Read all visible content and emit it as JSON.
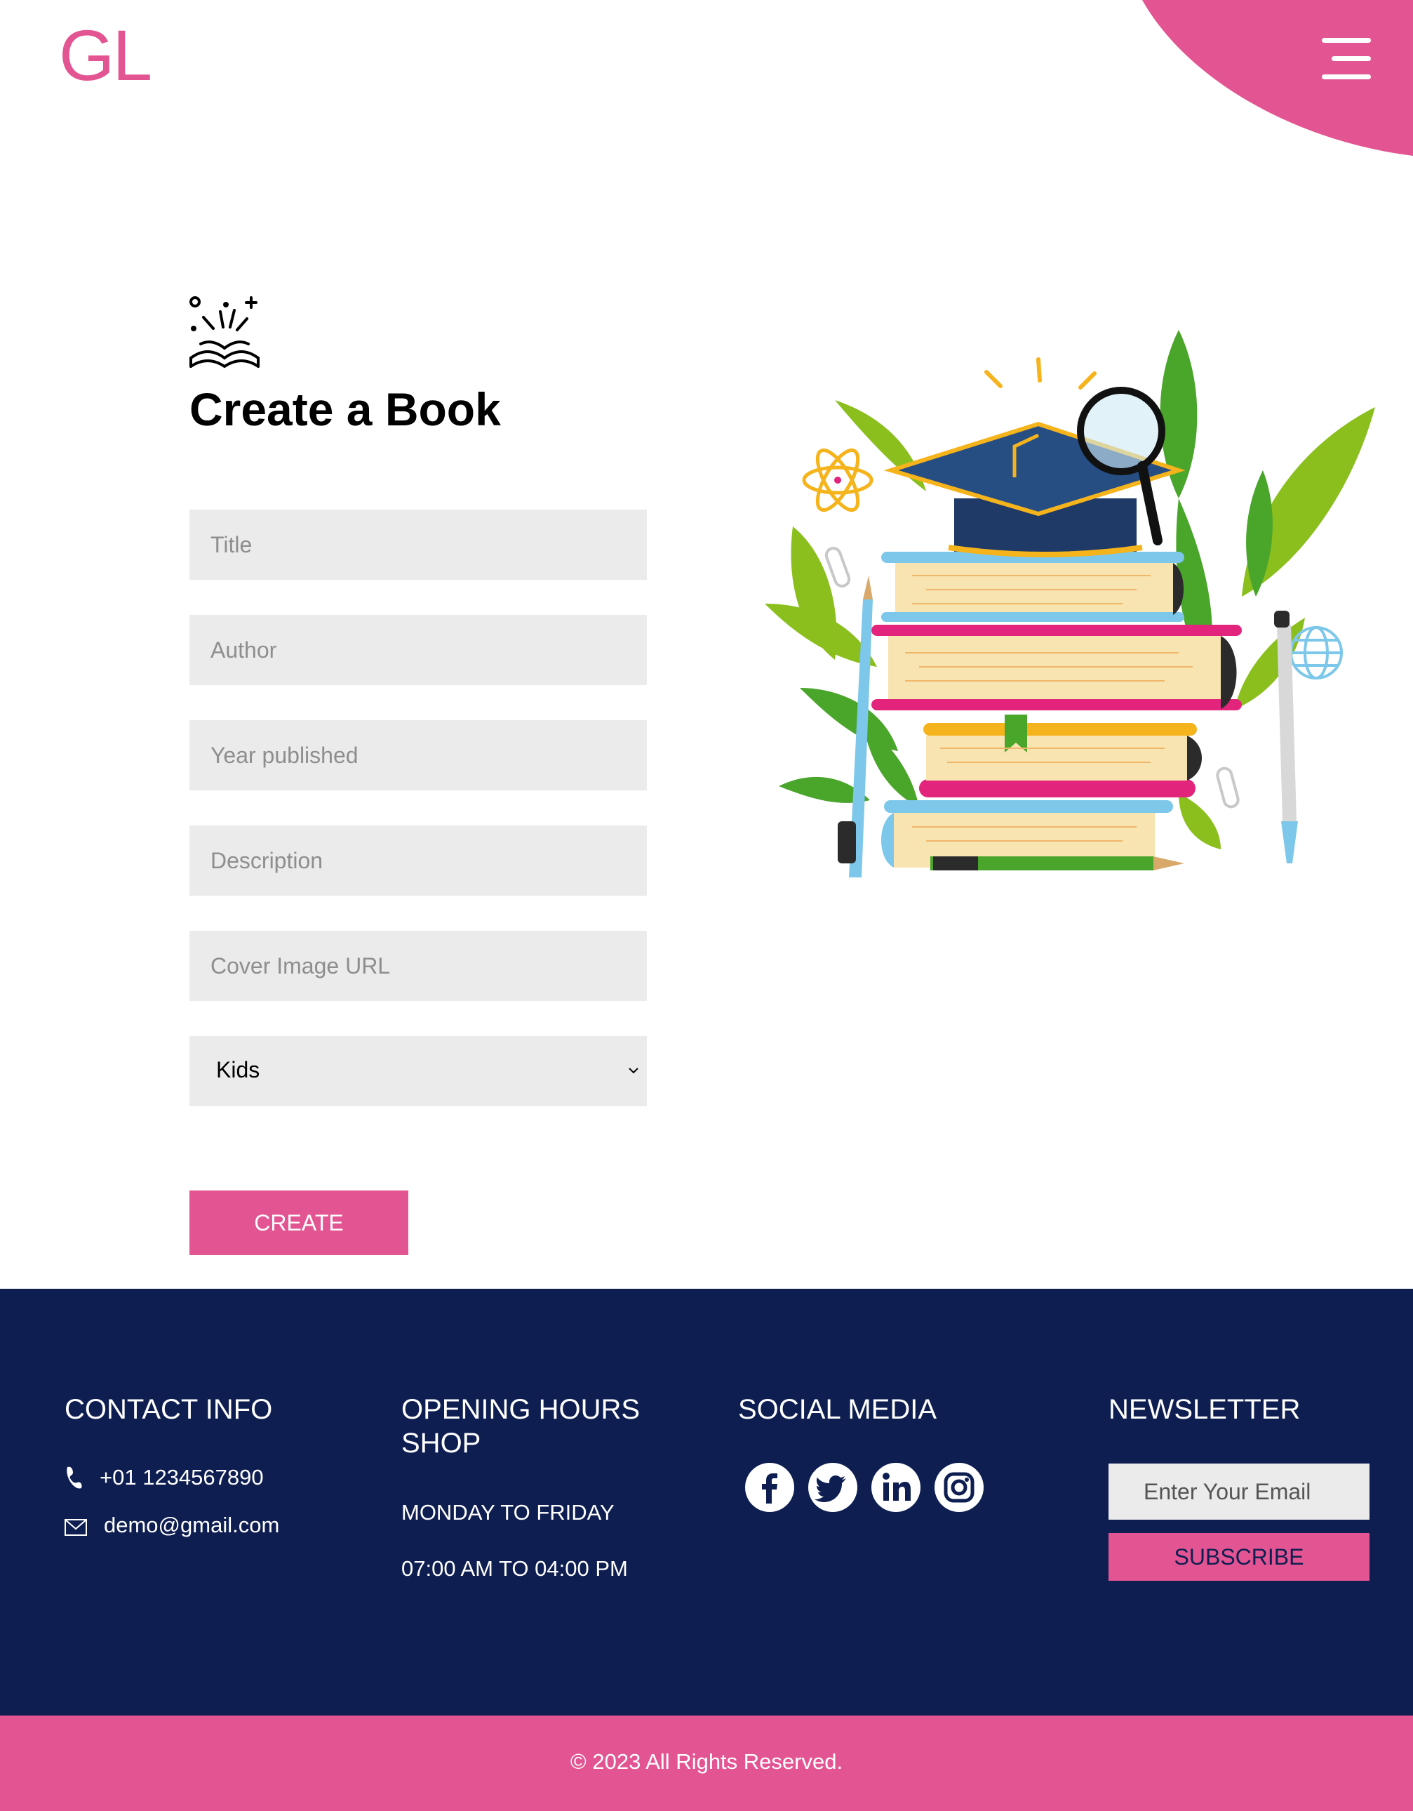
{
  "brand": {
    "logo_text": "GL",
    "accent_color": "#e35592"
  },
  "header": {
    "menu_icon": "hamburger-menu-icon"
  },
  "form": {
    "icon": "open-book-sparkle-icon",
    "title": "Create a Book",
    "fields": {
      "title_placeholder": "Title",
      "author_placeholder": "Author",
      "year_placeholder": "Year published",
      "description_placeholder": "Description",
      "cover_placeholder": "Cover Image URL"
    },
    "category": {
      "selected": "Kids"
    },
    "submit_label": "CREATE"
  },
  "illustration": {
    "name": "stack-of-books-illustration"
  },
  "footer": {
    "background_color": "#0e1e51",
    "contact": {
      "heading": "CONTACT INFO",
      "phone": "+01 1234567890",
      "email": "demo@gmail.com"
    },
    "hours": {
      "heading": "OPENING HOURS SHOP",
      "days": "MONDAY TO FRIDAY",
      "time": "07:00 AM TO 04:00 PM"
    },
    "social": {
      "heading": "SOCIAL MEDIA",
      "icons": [
        "facebook-icon",
        "twitter-icon",
        "linkedin-icon",
        "instagram-icon"
      ]
    },
    "newsletter": {
      "heading": "NEWSLETTER",
      "placeholder": "Enter Your Email",
      "button_label": "SUBSCRIBE"
    }
  },
  "copyright": "© 2023 All Rights Reserved."
}
